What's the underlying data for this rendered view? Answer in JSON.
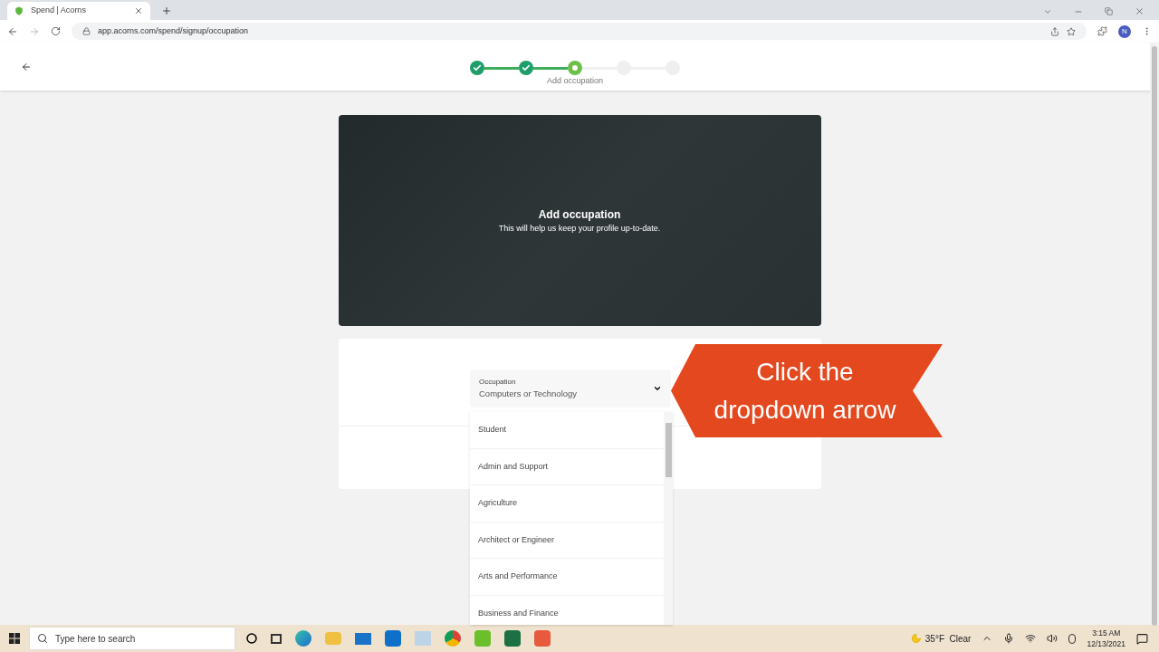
{
  "browser": {
    "tab_title": "Spend | Acorns",
    "url": "app.acorns.com/spend/signup/occupation",
    "profile_initial": "N"
  },
  "stepper": [
    {
      "kind": "done"
    },
    {
      "kind": "done"
    },
    {
      "kind": "current",
      "label": "Add occupation"
    },
    {
      "kind": "todo"
    },
    {
      "kind": "todo"
    }
  ],
  "hero": {
    "title": "Add occupation",
    "subtitle": "This will help us keep your profile up-to-date."
  },
  "occupation_field": {
    "label": "Occupation",
    "value": "Computers or Technology",
    "expanded": true
  },
  "options": [
    "Student",
    "Admin and Support",
    "Agriculture",
    "Architect or Engineer",
    "Arts and Performance",
    "Business and Finance"
  ],
  "callout": {
    "lines": [
      "Click the",
      "dropdown arrow"
    ]
  },
  "taskbar": {
    "search_placeholder": "Type here to search",
    "weather": "35°F  Clear",
    "time": "3:15 AM",
    "date": "12/13/2021"
  }
}
